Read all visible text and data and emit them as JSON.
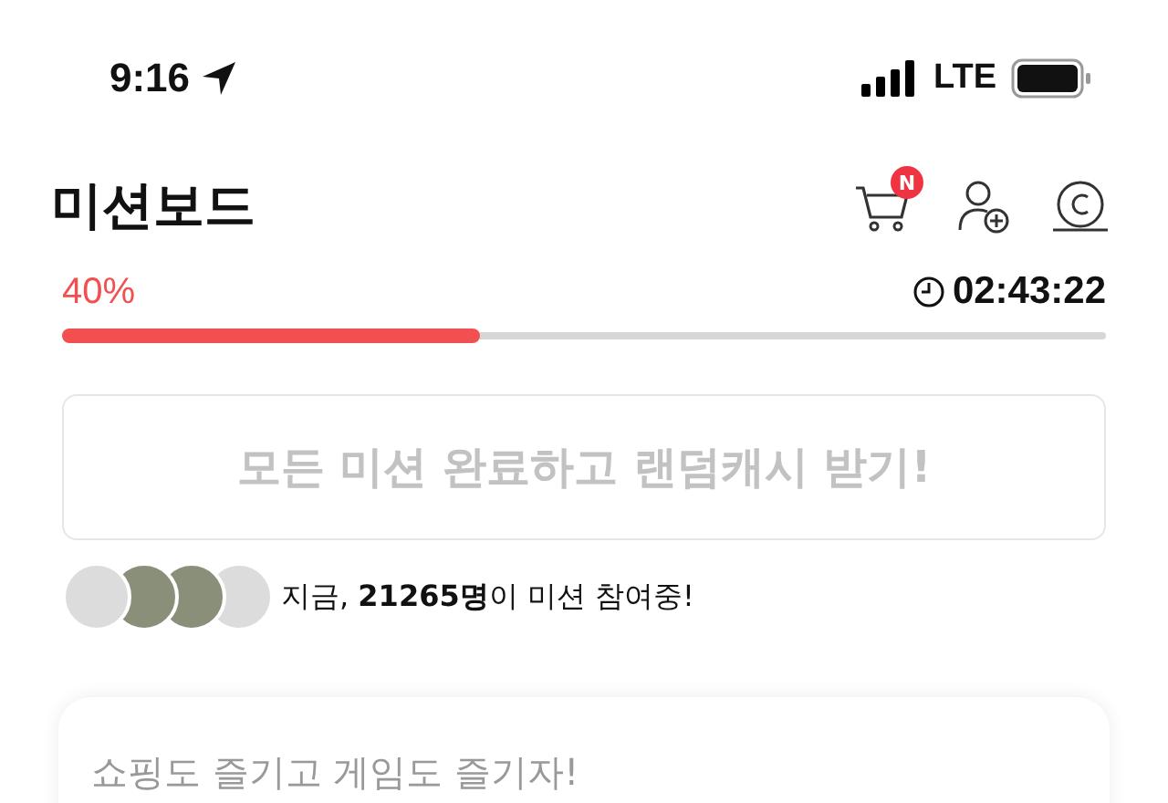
{
  "status_bar": {
    "time": "9:16",
    "network": "LTE"
  },
  "header": {
    "title": "미션보드",
    "cart_badge": "N"
  },
  "progress": {
    "percent": "40%",
    "level": 0.4,
    "timer": "02:43:22"
  },
  "reward_button": {
    "label": "모든 미션 완료하고 랜덤캐시 받기!",
    "disabled": true
  },
  "participants": {
    "avatars": [
      {
        "kind": "default"
      },
      {
        "kind": "photo"
      },
      {
        "kind": "photo"
      },
      {
        "kind": "default"
      }
    ],
    "text": "지금, **21265명**이 미션 참여중!"
  },
  "card": {
    "title": "쇼핑도 즐기고 게임도 즐기자!"
  }
}
